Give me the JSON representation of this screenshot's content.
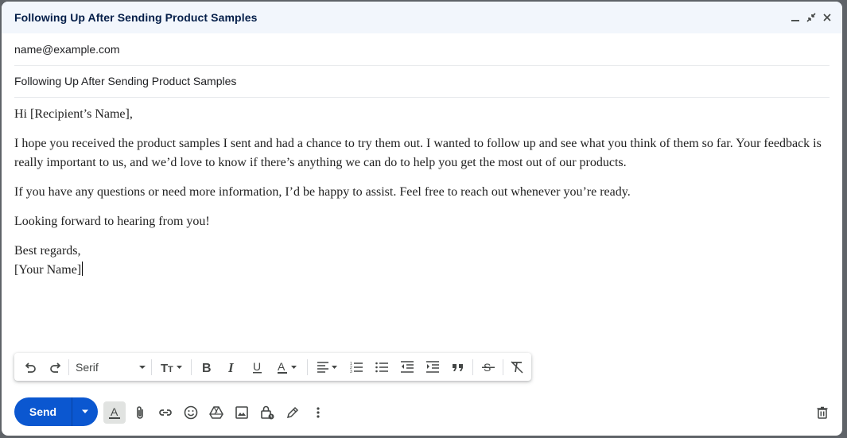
{
  "window": {
    "title": "Following Up After Sending Product Samples",
    "controls": [
      "minimize-icon",
      "exit-fullscreen-icon",
      "close-icon"
    ]
  },
  "compose": {
    "to": "name@example.com",
    "subject": "Following Up After Sending Product Samples",
    "body": {
      "greeting": "Hi [Recipient’s Name],",
      "para1": "I hope you received the product samples I sent and had a chance to try them out. I wanted to follow up and see what you think of them so far. Your feedback is really important to us, and we’d love to know if there’s anything we can do to help you get the most out of our products.",
      "para2": "If you have any questions or need more information, I’d be happy to assist. Feel free to reach out whenever you’re ready.",
      "para3": "Looking forward to hearing from you!",
      "closing": "Best regards,",
      "signature": "[Your Name]"
    }
  },
  "format_toolbar": {
    "font": "Serif",
    "icons": [
      "undo-icon",
      "redo-icon",
      "text-size-icon",
      "bold-icon",
      "italic-icon",
      "underline-icon",
      "text-color-icon",
      "align-icon",
      "numbered-list-icon",
      "bulleted-list-icon",
      "indent-less-icon",
      "indent-more-icon",
      "quote-icon",
      "strikethrough-icon",
      "remove-formatting-icon"
    ]
  },
  "bottom_bar": {
    "send_label": "Send",
    "icons": [
      "formatting-options-icon",
      "attach-icon",
      "link-icon",
      "emoji-icon",
      "drive-icon",
      "photo-icon",
      "confidential-icon",
      "signature-icon",
      "more-options-icon",
      "discard-icon"
    ]
  },
  "colors": {
    "primary": "#0b57d0",
    "titlebar_bg": "#f2f6fc",
    "title_text": "#041e49"
  }
}
